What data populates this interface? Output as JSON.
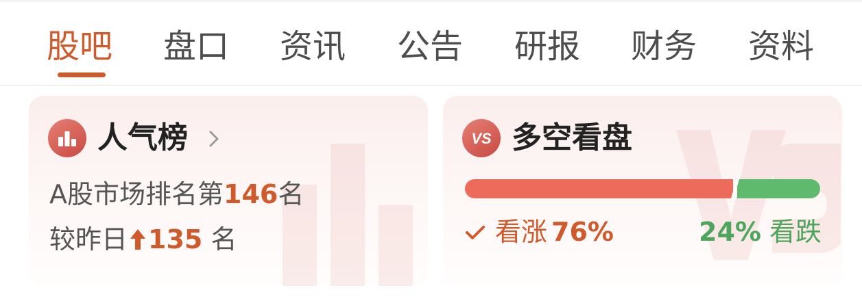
{
  "tabs": [
    {
      "label": "股吧",
      "active": true
    },
    {
      "label": "盘口"
    },
    {
      "label": "资讯"
    },
    {
      "label": "公告"
    },
    {
      "label": "研报"
    },
    {
      "label": "财务"
    },
    {
      "label": "资料"
    }
  ],
  "popularity": {
    "title": "人气榜",
    "rank_prefix": "A股市场排名第",
    "rank_value": "146",
    "rank_suffix": "名",
    "change_prefix": "较昨日",
    "change_value": "135",
    "change_suffix": "名",
    "change_direction": "up"
  },
  "sentiment": {
    "title": "多空看盘",
    "icon_text": "VS",
    "bull_label": "看涨",
    "bull_percent": "76%",
    "bull_fraction": 0.76,
    "bear_label": "看跌",
    "bear_percent": "24%",
    "bear_fraction": 0.24
  },
  "colors": {
    "accent": "#cf5a2c",
    "bull": "#ec6b5b",
    "bear": "#5fba6e"
  }
}
